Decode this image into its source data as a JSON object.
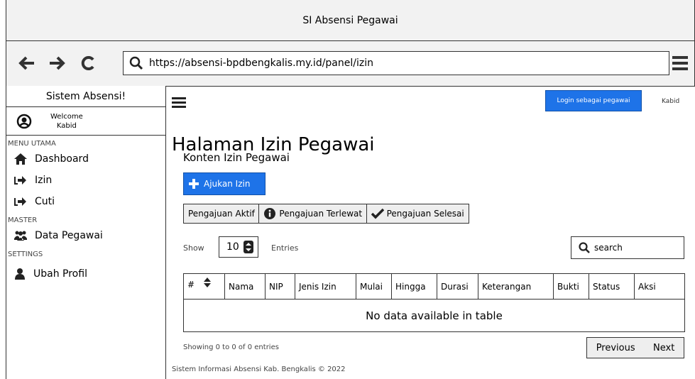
{
  "window": {
    "title": "SI Absensi Pegawai"
  },
  "browser": {
    "url": "https://absensi-bpdbengkalis.my.id/panel/izin"
  },
  "sidebar": {
    "brand": "Sistem Absensi!",
    "welcome": "Welcome",
    "user": "Kabid",
    "sections": [
      {
        "title": "MENU UTAMA",
        "items": [
          {
            "label": "Dashboard",
            "icon": "home-icon"
          },
          {
            "label": "Izin",
            "icon": "sign-in-icon"
          },
          {
            "label": "Cuti",
            "icon": "sign-in-icon"
          }
        ]
      },
      {
        "title": "MASTER",
        "items": [
          {
            "label": "Data Pegawai",
            "icon": "users-icon"
          }
        ]
      },
      {
        "title": "SETTINGS",
        "items": [
          {
            "label": "Ubah Profil",
            "icon": "user-icon"
          }
        ]
      }
    ]
  },
  "header": {
    "login_label": "Login sebagai pegawai",
    "user": "Kabid"
  },
  "main": {
    "title": "Halaman Izin Pegawai",
    "subtitle": "Konten Izin Pegawai",
    "add_button": "Ajukan Izin",
    "tabs": [
      "Pengajuan Aktif",
      "Pengajuan Terlewat",
      "Pengajuan Selesai"
    ],
    "show_label": "Show",
    "show_value": "10",
    "entries_label": "Entries",
    "search_placeholder": "search",
    "table": {
      "columns": [
        "#",
        "Nama",
        "NIP",
        "Jenis Izin",
        "Mulai",
        "Hingga",
        "Durasi",
        "Keterangan",
        "Bukti",
        "Status",
        "Aksi"
      ],
      "empty": "No data available in table"
    },
    "info": "Showing 0 to 0 of 0 entries",
    "prev": "Previous",
    "next": "Next",
    "footer": "Sistem Informasi Absensi Kab. Bengkalis © 2022"
  },
  "colors": {
    "primary": "#1e73e8",
    "border": "#333333",
    "chrome": "#f2f2f2"
  }
}
